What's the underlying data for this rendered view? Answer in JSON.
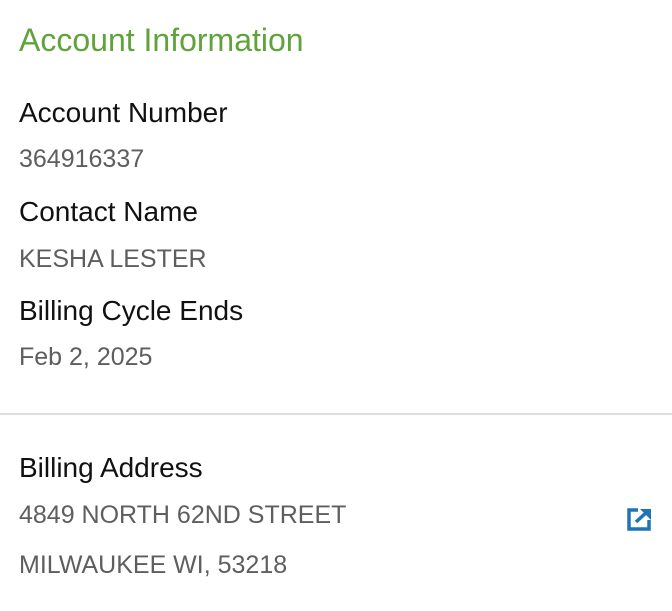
{
  "section": {
    "title": "Account Information"
  },
  "account": {
    "number_label": "Account Number",
    "number": "364916337",
    "contact_label": "Contact Name",
    "contact": "KESHA LESTER",
    "cycle_label": "Billing Cycle Ends",
    "cycle": "Feb 2, 2025"
  },
  "address": {
    "label": "Billing Address",
    "line1": "4849 NORTH 62ND STREET",
    "line2": "MILWAUKEE WI, 53218",
    "icon": "external-link-icon",
    "icon_color": "#1f73b7"
  },
  "colors": {
    "accent": "#5fa33a"
  }
}
